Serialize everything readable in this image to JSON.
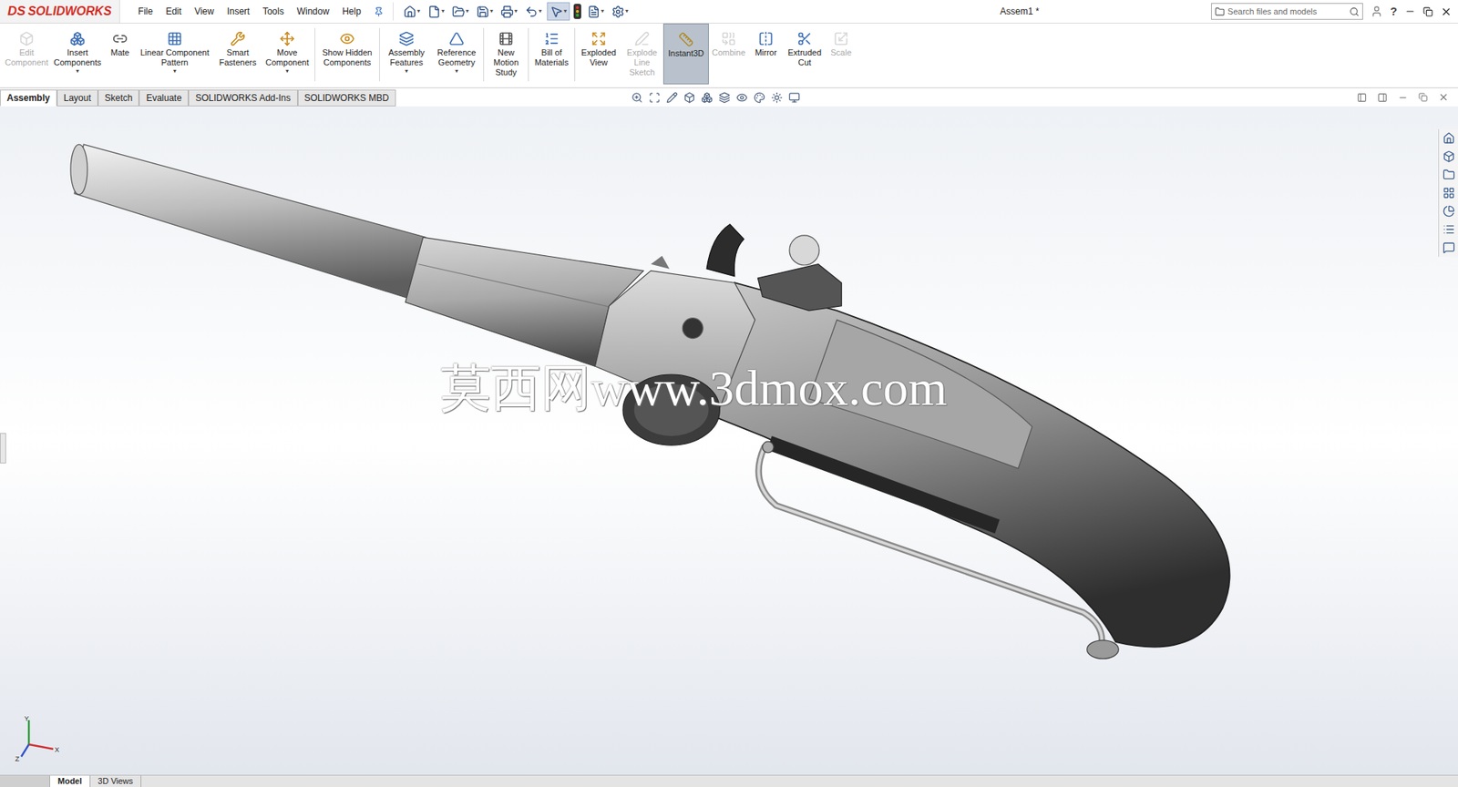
{
  "app": {
    "logo_mark": "DS",
    "logo_name": "SOLIDWORKS"
  },
  "menu": [
    "File",
    "Edit",
    "View",
    "Insert",
    "Tools",
    "Window",
    "Help"
  ],
  "window": {
    "title": "Assem1 *"
  },
  "search": {
    "placeholder": "Search files and models"
  },
  "help": "?",
  "ribbon": [
    {
      "label": "Edit Component",
      "disabled": true,
      "selected": false,
      "dropdown": false,
      "separator_after": false
    },
    {
      "label": "Insert Components",
      "disabled": false,
      "selected": false,
      "dropdown": true,
      "separator_after": false
    },
    {
      "label": "Mate",
      "disabled": false,
      "selected": false,
      "dropdown": false,
      "separator_after": false
    },
    {
      "label": "Linear Component Pattern",
      "disabled": false,
      "selected": false,
      "dropdown": true,
      "separator_after": false
    },
    {
      "label": "Smart Fasteners",
      "disabled": false,
      "selected": false,
      "dropdown": false,
      "separator_after": false
    },
    {
      "label": "Move Component",
      "disabled": false,
      "selected": false,
      "dropdown": true,
      "separator_after": true
    },
    {
      "label": "Show Hidden Components",
      "disabled": false,
      "selected": false,
      "dropdown": false,
      "separator_after": true
    },
    {
      "label": "Assembly Features",
      "disabled": false,
      "selected": false,
      "dropdown": true,
      "separator_after": false
    },
    {
      "label": "Reference Geometry",
      "disabled": false,
      "selected": false,
      "dropdown": true,
      "separator_after": true
    },
    {
      "label": "New Motion Study",
      "disabled": false,
      "selected": false,
      "dropdown": false,
      "separator_after": true
    },
    {
      "label": "Bill of Materials",
      "disabled": false,
      "selected": false,
      "dropdown": false,
      "separator_after": true
    },
    {
      "label": "Exploded View",
      "disabled": false,
      "selected": false,
      "dropdown": false,
      "separator_after": false
    },
    {
      "label": "Explode Line Sketch",
      "disabled": true,
      "selected": false,
      "dropdown": false,
      "separator_after": false
    },
    {
      "label": "Instant3D",
      "disabled": false,
      "selected": true,
      "dropdown": false,
      "separator_after": false
    },
    {
      "label": "Combine",
      "disabled": true,
      "selected": false,
      "dropdown": false,
      "separator_after": false
    },
    {
      "label": "Mirror",
      "disabled": false,
      "selected": false,
      "dropdown": false,
      "separator_after": false
    },
    {
      "label": "Extruded Cut",
      "disabled": false,
      "selected": false,
      "dropdown": false,
      "separator_after": false
    },
    {
      "label": "Scale",
      "disabled": true,
      "selected": false,
      "dropdown": false,
      "separator_after": false
    }
  ],
  "tabs": [
    {
      "label": "Assembly",
      "selected": true
    },
    {
      "label": "Layout",
      "selected": false
    },
    {
      "label": "Sketch",
      "selected": false
    },
    {
      "label": "Evaluate",
      "selected": false
    },
    {
      "label": "SOLIDWORKS Add-Ins",
      "selected": false
    },
    {
      "label": "SOLIDWORKS MBD",
      "selected": false
    }
  ],
  "watermark": "莫西网www.3dmox.com",
  "triad": {
    "x": "X",
    "y": "Y",
    "z": "Z"
  },
  "bottom_tabs": [
    {
      "label": "Model",
      "selected": true
    },
    {
      "label": "3D Views",
      "selected": false
    }
  ]
}
